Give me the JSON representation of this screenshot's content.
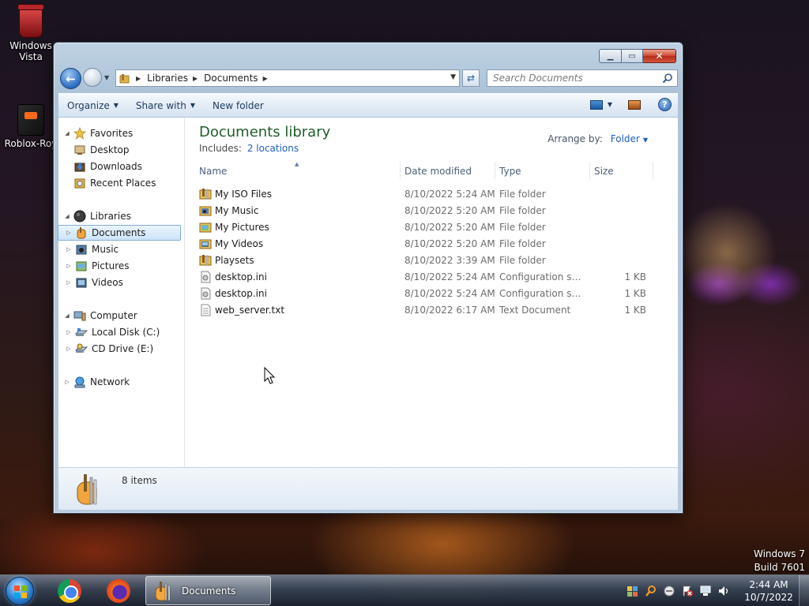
{
  "desktop": {
    "icons": [
      {
        "label": "Windows Vista",
        "icon": "recycle-bin-icon"
      },
      {
        "label": "Roblox-Roy",
        "icon": "roblox-shortcut-icon"
      }
    ],
    "watermark": {
      "line1": "Windows 7",
      "line2": "Build 7601"
    }
  },
  "window": {
    "address": {
      "crumbs": [
        "Libraries",
        "Documents"
      ]
    },
    "search_placeholder": "Search Documents",
    "commands": {
      "organize": "Organize",
      "share_with": "Share with",
      "new_folder": "New folder"
    },
    "caption": {
      "minimize": "▁",
      "maximize": "▭",
      "close": "✕"
    },
    "nav": {
      "favorites": {
        "label": "Favorites",
        "items": [
          "Desktop",
          "Downloads",
          "Recent Places"
        ]
      },
      "libraries": {
        "label": "Libraries",
        "items": [
          "Documents",
          "Music",
          "Pictures",
          "Videos"
        ]
      },
      "computer": {
        "label": "Computer",
        "items": [
          "Local Disk (C:)",
          "CD Drive (E:)"
        ]
      },
      "network": {
        "label": "Network"
      }
    },
    "library": {
      "title": "Documents library",
      "includes_label": "Includes:",
      "includes_link": "2 locations",
      "arrange_label": "Arrange by:",
      "arrange_value": "Folder"
    },
    "columns": {
      "name": "Name",
      "date": "Date modified",
      "type": "Type",
      "size": "Size"
    },
    "files": [
      {
        "name": "My ISO Files",
        "date": "8/10/2022 5:24 AM",
        "type": "File folder",
        "size": "",
        "icon": "folder-icon"
      },
      {
        "name": "My Music",
        "date": "8/10/2022 5:20 AM",
        "type": "File folder",
        "size": "",
        "icon": "music-folder-icon"
      },
      {
        "name": "My Pictures",
        "date": "8/10/2022 5:20 AM",
        "type": "File folder",
        "size": "",
        "icon": "pictures-folder-icon"
      },
      {
        "name": "My Videos",
        "date": "8/10/2022 5:20 AM",
        "type": "File folder",
        "size": "",
        "icon": "videos-folder-icon"
      },
      {
        "name": "Playsets",
        "date": "8/10/2022 3:39 AM",
        "type": "File folder",
        "size": "",
        "icon": "folder-icon"
      },
      {
        "name": "desktop.ini",
        "date": "8/10/2022 5:24 AM",
        "type": "Configuration sett...",
        "size": "1 KB",
        "icon": "config-file-icon"
      },
      {
        "name": "desktop.ini",
        "date": "8/10/2022 5:24 AM",
        "type": "Configuration sett...",
        "size": "1 KB",
        "icon": "config-file-icon"
      },
      {
        "name": "web_server.txt",
        "date": "8/10/2022 6:17 AM",
        "type": "Text Document",
        "size": "1 KB",
        "icon": "text-file-icon"
      }
    ],
    "details": {
      "count": "8 items"
    }
  },
  "taskbar": {
    "window_button": "Documents",
    "clock_time": "2:44 AM",
    "clock_date": "10/7/2022"
  }
}
